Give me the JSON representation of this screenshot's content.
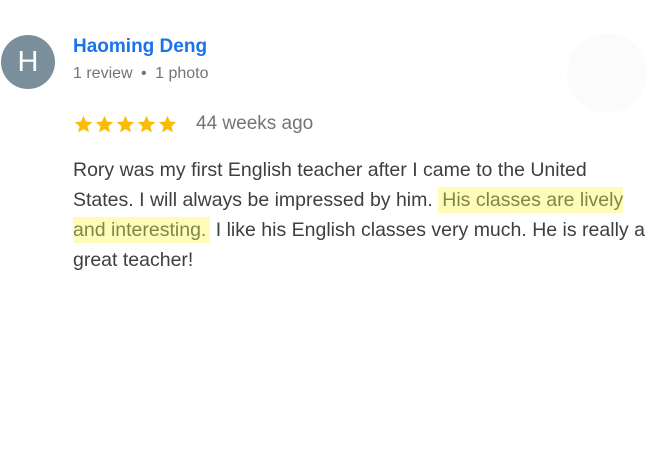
{
  "reviewer": {
    "initial": "H",
    "name": "Haoming Deng",
    "review_count": "1 review",
    "separator": "•",
    "photo_count": "1 photo"
  },
  "review": {
    "rating": 5,
    "max_rating": 5,
    "time_ago": "44 weeks ago",
    "text_before": "Rory was my first English teacher after I came to the United States. I will always be impressed by him.",
    "text_highlight": "His classes are lively and interesting.",
    "text_after": "I like his English classes very much. He is really a great teacher!"
  },
  "colors": {
    "name_link": "#1a73e8",
    "star": "#fbbc04",
    "highlight_bg": "#fffbb8",
    "avatar_bg": "#7a8f9b"
  },
  "icons": {
    "star": "star-icon"
  }
}
